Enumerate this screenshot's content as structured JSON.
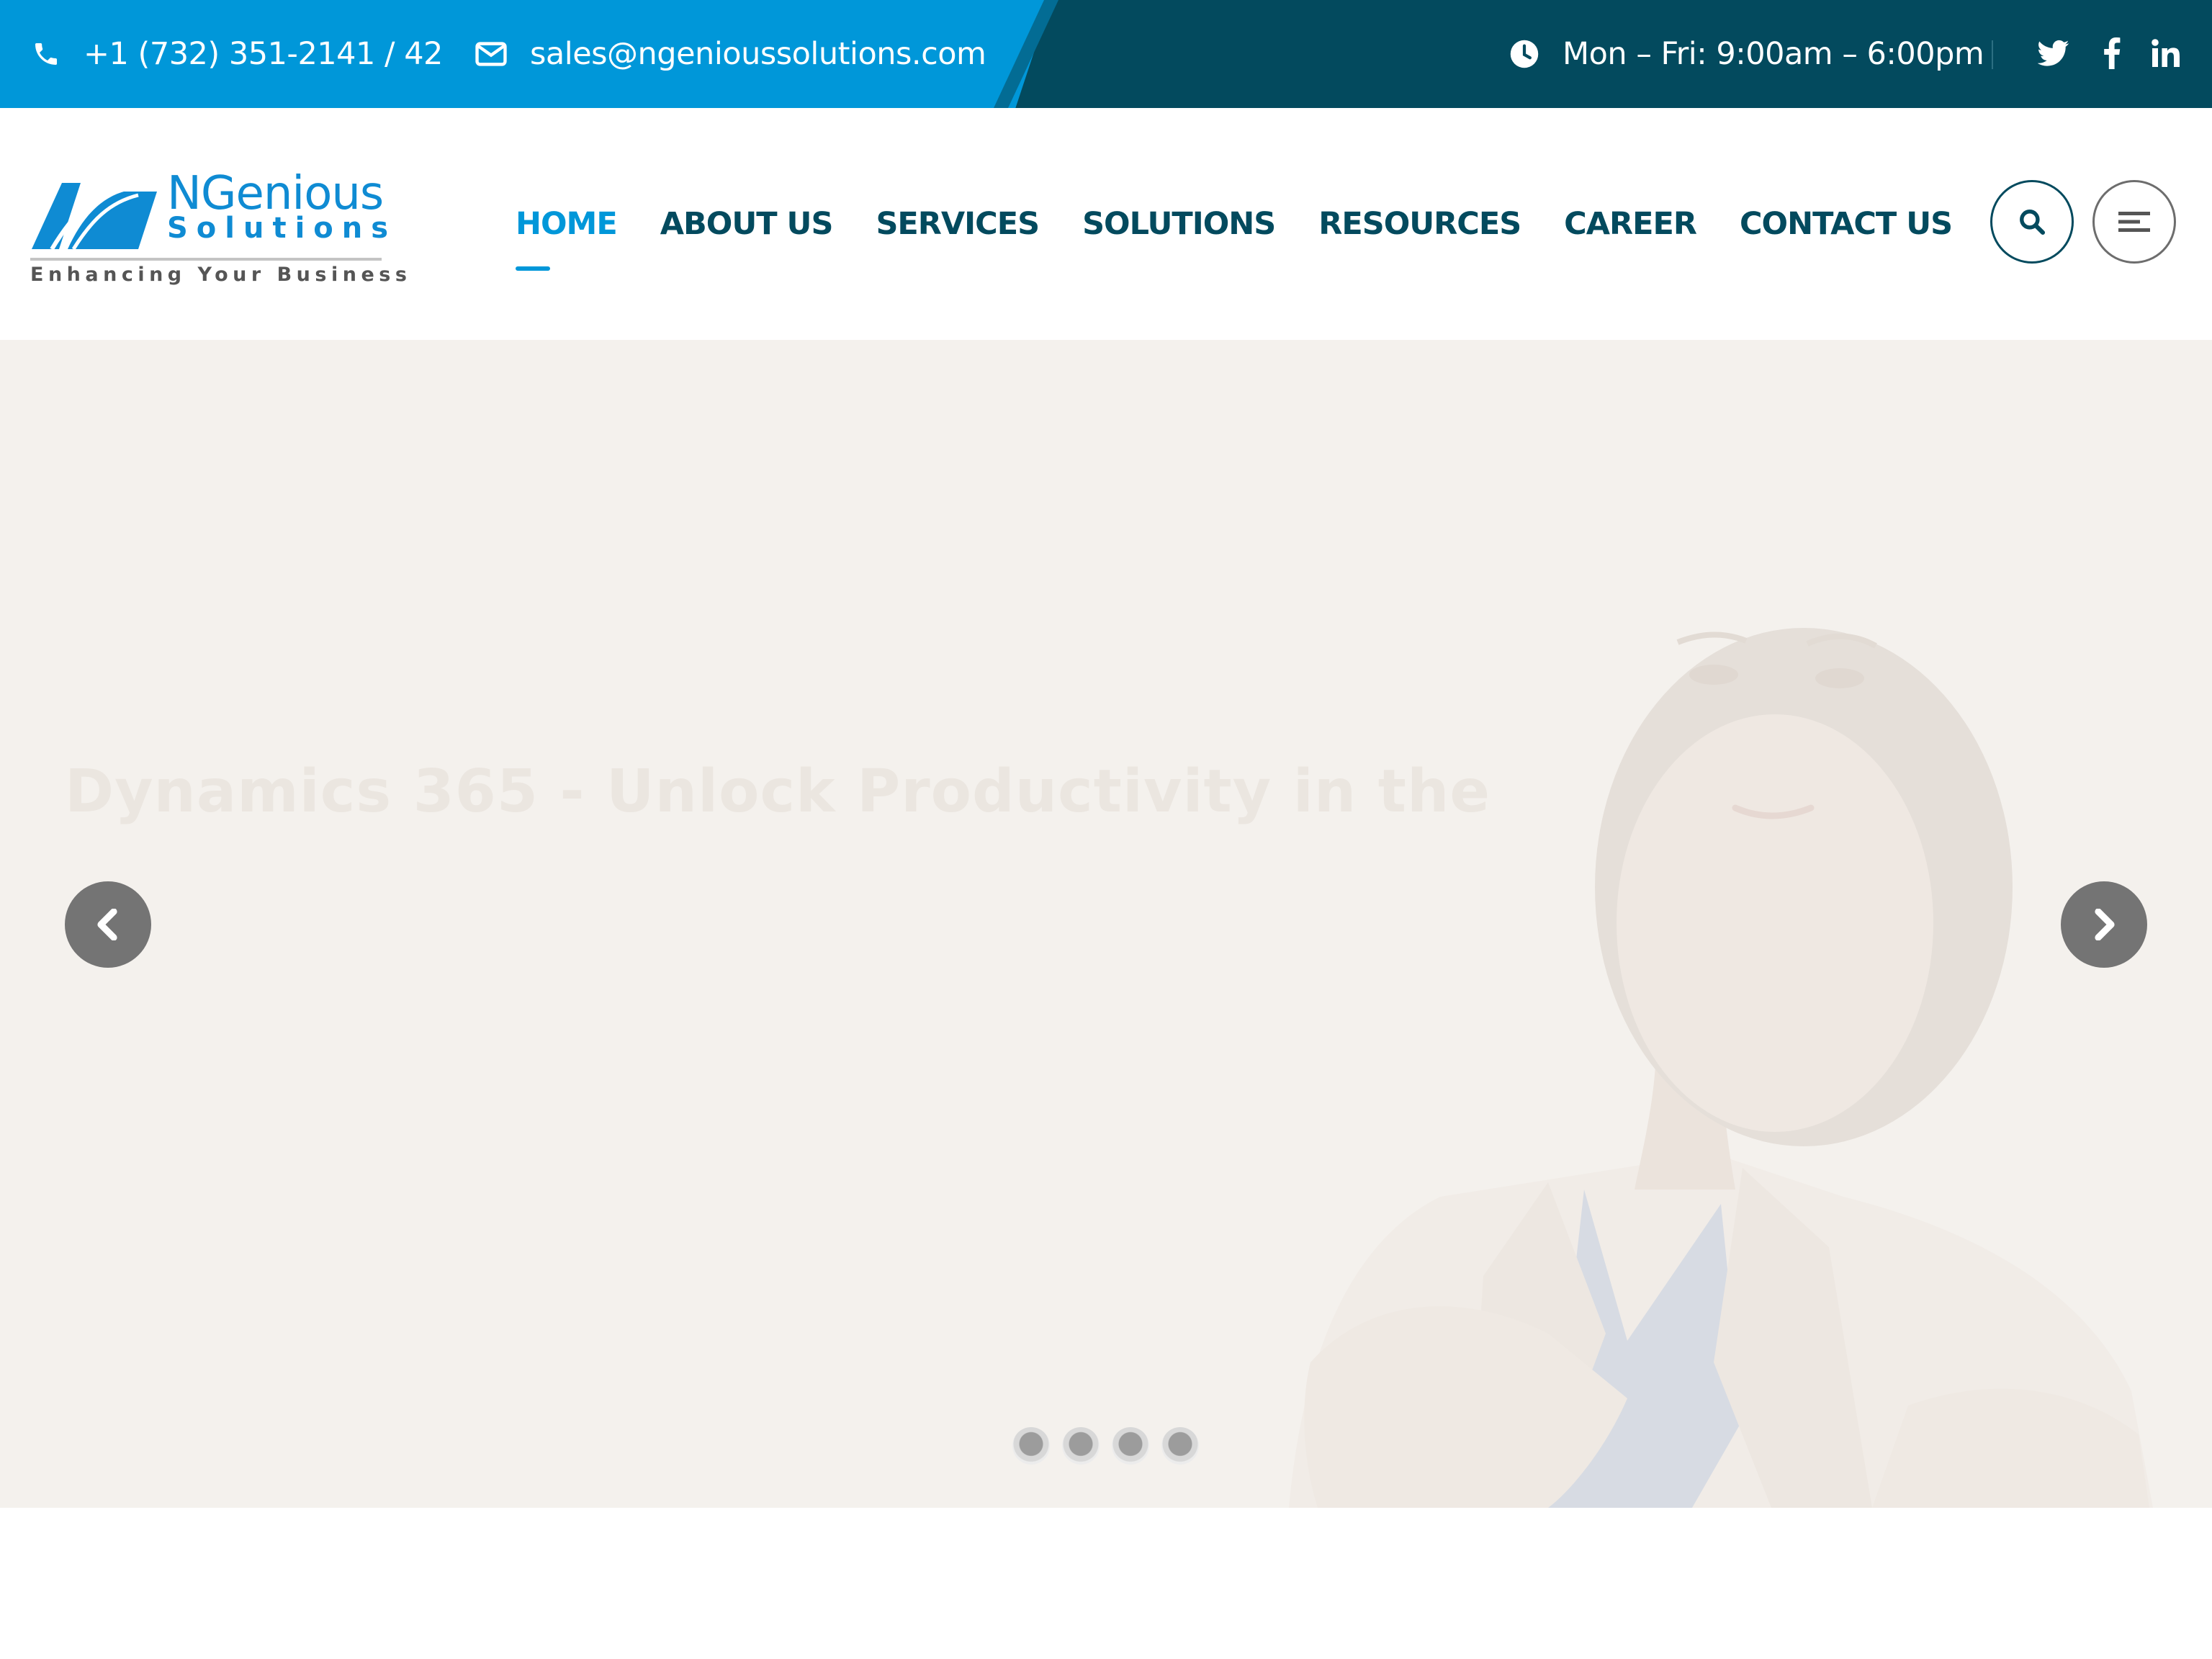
{
  "topbar": {
    "phone": "+1 (732) 351-2141 / 42",
    "email": "sales@ngenioussolutions.com",
    "hours": "Mon – Fri: 9:00am – 6:00pm",
    "social_icons": [
      "twitter-icon",
      "facebook-icon",
      "linkedin-icon"
    ]
  },
  "header": {
    "logo": {
      "name_line1": "NGenious",
      "name_line2": "Solutions",
      "tagline": "Enhancing Your Business"
    },
    "nav": [
      {
        "label": "HOME",
        "active": true
      },
      {
        "label": "ABOUT US",
        "active": false
      },
      {
        "label": "SERVICES",
        "active": false
      },
      {
        "label": "SOLUTIONS",
        "active": false
      },
      {
        "label": "RESOURCES",
        "active": false
      },
      {
        "label": "CAREER",
        "active": false
      },
      {
        "label": "CONTACT US",
        "active": false
      }
    ],
    "buttons": [
      "search-icon",
      "menu-icon"
    ]
  },
  "hero": {
    "slide_title": "Dynamics 365 - Unlock Productivity in the",
    "slide_count": 4,
    "active_slide": 1
  },
  "colors": {
    "primary_blue": "#0097d9",
    "dark_teal": "#034a5e",
    "hero_bg": "#f4f1ed",
    "arrow_bg": "#747474"
  }
}
